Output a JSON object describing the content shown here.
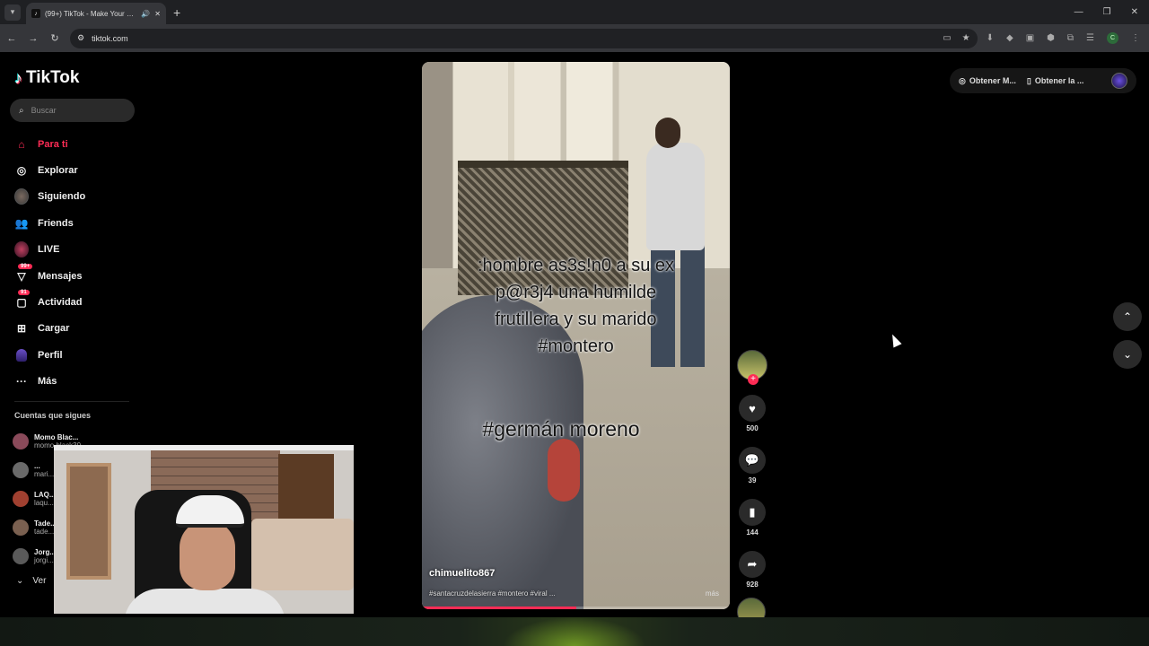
{
  "browser": {
    "tab_title": "(99+) TikTok - Make Your Day",
    "url": "tiktok.com",
    "new_tab": "+",
    "profile_initial": "C"
  },
  "app": {
    "logo_text": "TikTok",
    "search_placeholder": "Buscar"
  },
  "nav": [
    {
      "label": "Para ti",
      "icon": "home-icon",
      "active": true
    },
    {
      "label": "Explorar",
      "icon": "compass-icon"
    },
    {
      "label": "Siguiendo",
      "icon": "following-avatar-icon"
    },
    {
      "label": "Friends",
      "icon": "friends-icon"
    },
    {
      "label": "LIVE",
      "icon": "live-icon"
    },
    {
      "label": "Mensajes",
      "icon": "messages-icon",
      "badge": "99+"
    },
    {
      "label": "Actividad",
      "icon": "activity-icon",
      "badge": "91"
    },
    {
      "label": "Cargar",
      "icon": "upload-icon"
    },
    {
      "label": "Perfil",
      "icon": "profile-icon"
    },
    {
      "label": "Más",
      "icon": "more-icon"
    }
  ],
  "following": {
    "title": "Cuentas que sigues",
    "items": [
      {
        "name": "Momo Blac...",
        "handle": "momo.black30",
        "color": "#8a4a5a"
      },
      {
        "name": "...",
        "handle": "mari...",
        "color": "#6a6a6a"
      },
      {
        "name": "LAQ...",
        "handle": "laqu...",
        "color": "#a04030"
      },
      {
        "name": "Tade...",
        "handle": "tade...",
        "color": "#7a6050"
      },
      {
        "name": "Jorg...",
        "handle": "jorgi...",
        "color": "#5a5a5a"
      }
    ],
    "see_more": "Ver"
  },
  "video": {
    "caption_lines": [
      ":hombre as3s!n0 a su ex",
      "p@r3j4 una humilde",
      "frutillera y su marido",
      "#montero"
    ],
    "caption2": "#germán moreno",
    "author": "chimuelito867",
    "tags": "#santacruzdelasierra #montero #viral ...",
    "more": "más",
    "progress": 0.5
  },
  "actions": {
    "likes": "500",
    "comments": "39",
    "saves": "144",
    "shares": "928"
  },
  "topright": {
    "btn1": "Obtener M...",
    "btn2": "Obtener la ..."
  }
}
